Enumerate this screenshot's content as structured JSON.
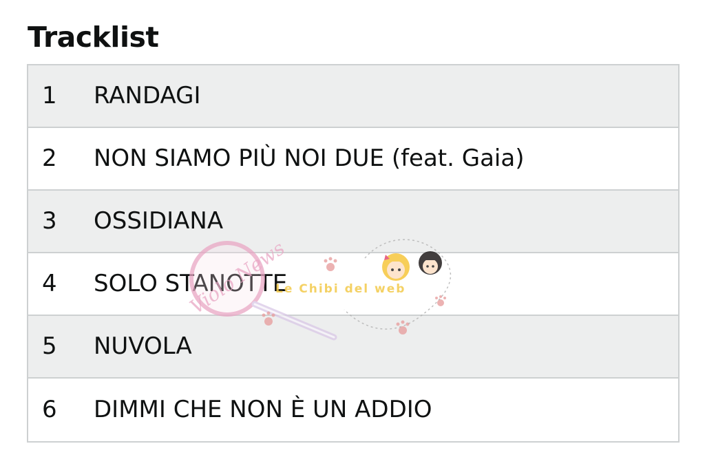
{
  "header": {
    "title": "Tracklist"
  },
  "tracks": [
    {
      "number": "1",
      "title": "RANDAGI"
    },
    {
      "number": "2",
      "title": "NON SIAMO PIÙ NOI DUE (feat. Gaia)"
    },
    {
      "number": "3",
      "title": "OSSIDIANA"
    },
    {
      "number": "4",
      "title": "SOLO STANOTTE"
    },
    {
      "number": "5",
      "title": "NUVOLA"
    },
    {
      "number": "6",
      "title": "DIMMI CHE NON È UN ADDIO"
    }
  ],
  "watermark": {
    "logo_text": "Violo News",
    "site_text": "Le Chibi del web"
  },
  "colors": {
    "row_shaded": "#edeeee",
    "border": "#cdd0d1",
    "text": "#0f1111",
    "watermark_pink": "#e9a6c4"
  }
}
